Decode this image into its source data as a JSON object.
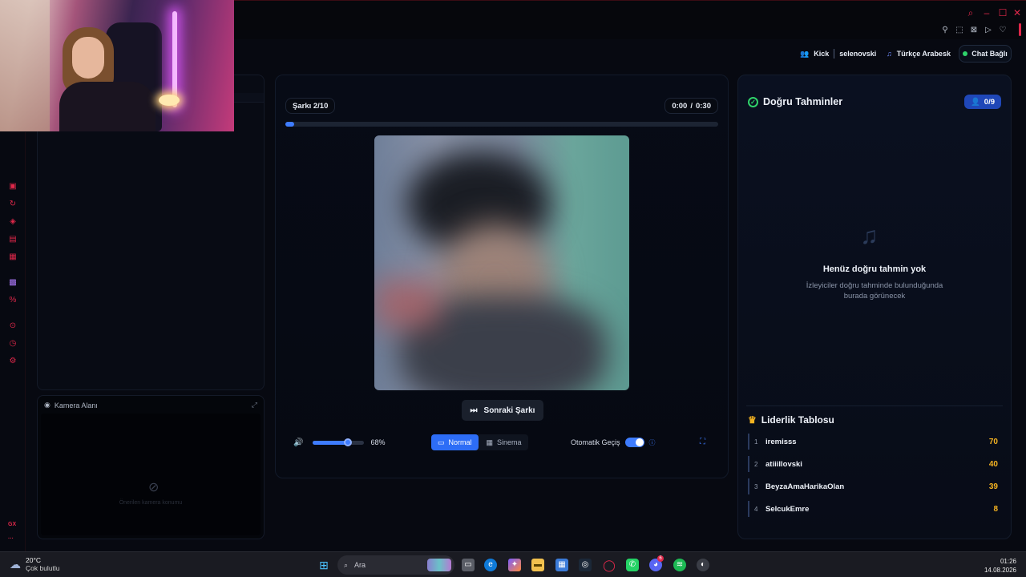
{
  "colors": {
    "accent": "#3e7cff",
    "brand_red": "#e0284a",
    "gold": "#f5b321",
    "success": "#2fd36a"
  },
  "status_bar": {
    "platform_label": "Kick",
    "platform_user": "selenovski",
    "music_genre": "Türkçe Arabesk",
    "chat_status": "Chat Bağlı"
  },
  "camera": {
    "title": "Kamera Alanı",
    "placeholder": "Önerilen kamera konumu"
  },
  "player": {
    "song_counter": "Şarkı 2/10",
    "time_current": "0:00",
    "time_separator": "/",
    "time_total": "0:30",
    "progress": 0.02,
    "next_button": "Sonraki Şarkı",
    "volume_percent_label": "68%",
    "volume": 0.68,
    "modes": [
      {
        "label": "Normal",
        "active": true,
        "icon": "monitor-icon"
      },
      {
        "label": "Sinema",
        "active": false,
        "icon": "film-icon"
      }
    ],
    "auto_switch_label": "Otomatik Geçiş",
    "auto_switch_on": true
  },
  "guesses": {
    "title": "Doğru Tahminler",
    "count": "0/9",
    "empty_title": "Henüz doğru tahmin yok",
    "empty_subtitle": "İzleyiciler doğru tahminde bulunduğunda burada görünecek"
  },
  "leaderboard": {
    "title": "Liderlik Tablosu",
    "rows": [
      {
        "rank": "1",
        "name": "iremisss",
        "score": "70"
      },
      {
        "rank": "2",
        "name": "atiiillovski",
        "score": "40"
      },
      {
        "rank": "3",
        "name": "BeyzaAmaHarikaOlan",
        "score": "39"
      },
      {
        "rank": "4",
        "name": "SelcukEmre",
        "score": "8"
      }
    ]
  },
  "taskbar": {
    "weather_temp": "20°C",
    "weather_desc": "Çok bulutlu",
    "search_label": "Ara",
    "time": "01:26",
    "date": "14.08.2026",
    "discord_badge": "6"
  },
  "rail": {
    "bottom_label": "GX"
  }
}
